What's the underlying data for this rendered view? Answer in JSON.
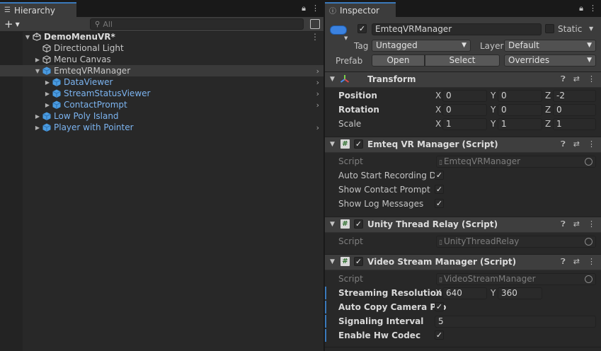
{
  "hierarchy": {
    "tab_label": "Hierarchy",
    "search_placeholder": "All",
    "scene": {
      "name": "DemoMenuVR*"
    },
    "items": [
      {
        "label": "Directional Light"
      },
      {
        "label": "Menu Canvas"
      },
      {
        "label": "EmteqVRManager"
      },
      {
        "label": "DataViewer"
      },
      {
        "label": "StreamStatusViewer"
      },
      {
        "label": "ContactPrompt"
      },
      {
        "label": "Low Poly Island"
      },
      {
        "label": "Player with Pointer"
      }
    ]
  },
  "inspector": {
    "tab_label": "Inspector",
    "object_name": "EmteqVRManager",
    "static_label": "Static",
    "tag_label": "Tag",
    "tag_value": "Untagged",
    "layer_label": "Layer",
    "layer_value": "Default",
    "prefab_label": "Prefab",
    "prefab_open": "Open",
    "prefab_select": "Select",
    "prefab_overrides": "Overrides",
    "transform": {
      "title": "Transform",
      "position_label": "Position",
      "rotation_label": "Rotation",
      "scale_label": "Scale",
      "axis_x": "X",
      "axis_y": "Y",
      "axis_z": "Z",
      "position": {
        "x": "0",
        "y": "0",
        "z": "-2"
      },
      "rotation": {
        "x": "0",
        "y": "0",
        "z": "0"
      },
      "scale": {
        "x": "1",
        "y": "1",
        "z": "1"
      }
    },
    "emteq_manager": {
      "title": "Emteq VR Manager (Script)",
      "script_label": "Script",
      "script_value": "EmteqVRManager",
      "auto_start_label": "Auto Start Recording Da",
      "show_contact_label": "Show Contact Prompt",
      "show_log_label": "Show Log Messages"
    },
    "thread_relay": {
      "title": "Unity Thread Relay (Script)",
      "script_label": "Script",
      "script_value": "UnityThreadRelay"
    },
    "video_stream": {
      "title": "Video Stream Manager (Script)",
      "script_label": "Script",
      "script_value": "VideoStreamManager",
      "resolution_label": "Streaming Resolution",
      "res_x_label": "X",
      "res_x": "640",
      "res_y_label": "Y",
      "res_y": "360",
      "auto_copy_label": "Auto Copy Camera Pro",
      "signaling_label": "Signaling Interval",
      "signaling_value": "5",
      "hw_codec_label": "Enable Hw Codec"
    }
  },
  "colors": {
    "accent": "#3a79bb",
    "link_blue": "#7cb4f0",
    "panel": "#282828",
    "header": "#3c3c3c"
  }
}
